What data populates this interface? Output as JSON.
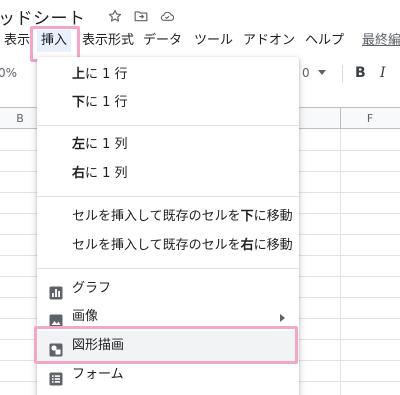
{
  "title": {
    "text": "ッドシート",
    "icons": [
      "star-icon",
      "move-to-folder-icon",
      "cloud-status-icon"
    ]
  },
  "menubar": {
    "items": [
      {
        "label": "表示",
        "active": false
      },
      {
        "label": "挿入",
        "active": true
      },
      {
        "label": "表示形式",
        "active": false
      },
      {
        "label": "データ",
        "active": false
      },
      {
        "label": "ツール",
        "active": false
      },
      {
        "label": "アドオン",
        "active": false
      },
      {
        "label": "ヘルプ",
        "active": false
      }
    ],
    "last_edit_label": "最終編"
  },
  "toolbar": {
    "zoom_fragment": "0%",
    "font_size_fragment": "0",
    "bold_label": "B",
    "italic_label": "I"
  },
  "columns": {
    "headers": [
      "B",
      "F"
    ]
  },
  "insert_menu": {
    "items": [
      {
        "pre": "",
        "bold": "上",
        "post": "に 1 行"
      },
      {
        "pre": "",
        "bold": "下",
        "post": "に 1 行"
      },
      {
        "pre": "",
        "bold": "左",
        "post": "に 1 列"
      },
      {
        "pre": "",
        "bold": "右",
        "post": "に 1 列"
      },
      {
        "pre": "セルを挿入して既存のセルを",
        "bold": "下",
        "post": "に移動"
      },
      {
        "pre": "セルを挿入して既存のセルを",
        "bold": "右",
        "post": "に移動"
      },
      {
        "label": "グラフ",
        "icon": "chart-icon"
      },
      {
        "label": "画像",
        "icon": "image-icon",
        "has_submenu": true
      },
      {
        "label": "図形描画",
        "icon": "drawing-icon",
        "highlighted": true
      },
      {
        "label": "フォーム",
        "icon": "form-icon"
      }
    ]
  },
  "colors": {
    "highlight_border": "#f4a6c8",
    "active_menu_bg": "#e8f0fe",
    "hover_bg": "#f1f3f4",
    "icon_gray": "#5f6368"
  }
}
